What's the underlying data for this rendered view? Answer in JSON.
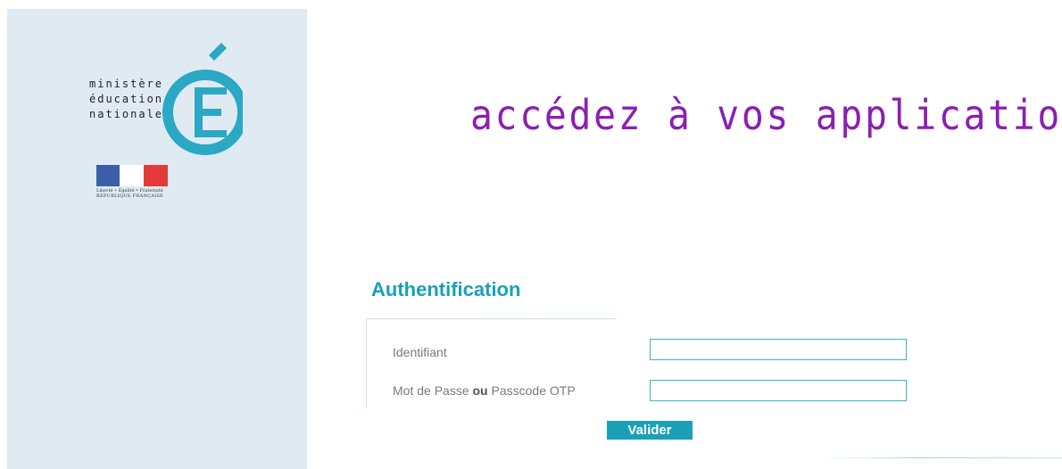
{
  "logo": {
    "line1": "ministère",
    "line2": "éducation",
    "line3": "nationale",
    "emblem_letter": "É",
    "motto": "Liberté • Égalité • Fraternité",
    "republic": "RÉPUBLIQUE FRANÇAISE",
    "emblem_color": "#2aa8c4",
    "flag_colors": [
      "#3a5fa8",
      "#ffffff",
      "#e33a3a"
    ]
  },
  "header": {
    "headline": "accédez à vos applications",
    "headline_color": "#8b1fb2"
  },
  "auth": {
    "title": "Authentification",
    "identifier_label": "Identifiant",
    "identifier_value": "",
    "password_label_pre": "Mot de Passe ",
    "password_label_bold": "ou",
    "password_label_post": " Passcode OTP",
    "password_value": "",
    "submit_label": "Valider",
    "accent_color": "#1aa0b8"
  }
}
